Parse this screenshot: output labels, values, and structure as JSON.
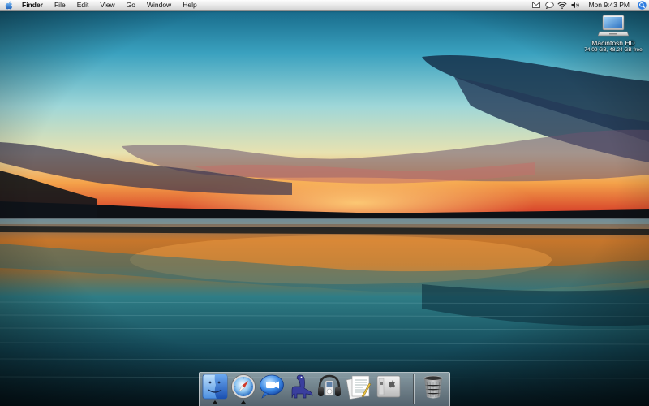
{
  "menubar": {
    "apple_icon": "apple-logo-icon",
    "app_name": "Finder",
    "menus": [
      "File",
      "Edit",
      "View",
      "Go",
      "Window",
      "Help"
    ],
    "status_icons": [
      "mail-icon",
      "ichat-bubble-icon",
      "wifi-icon",
      "volume-icon"
    ],
    "clock": "Mon 9:43 PM",
    "spotlight_icon": "spotlight-search-icon"
  },
  "desktop": {
    "drive": {
      "name": "Macintosh HD",
      "info": "74.09 GB, 48.24 GB free",
      "icon": "hard-drive-icon"
    }
  },
  "dock": {
    "items": [
      {
        "name": "finder",
        "icon": "finder-icon",
        "running": true
      },
      {
        "name": "safari",
        "icon": "safari-compass-icon",
        "running": true
      },
      {
        "name": "ichat",
        "icon": "ichat-bubble-icon",
        "running": false
      },
      {
        "name": "dashcode",
        "icon": "dinosaur-icon",
        "running": false
      },
      {
        "name": "itunes",
        "icon": "headphones-icon",
        "running": false
      },
      {
        "name": "textedit",
        "icon": "pages-document-icon",
        "running": false
      },
      {
        "name": "system-preferences",
        "icon": "apple-panel-icon",
        "running": false
      },
      {
        "name": "trash",
        "icon": "trash-can-icon",
        "running": false
      }
    ]
  }
}
